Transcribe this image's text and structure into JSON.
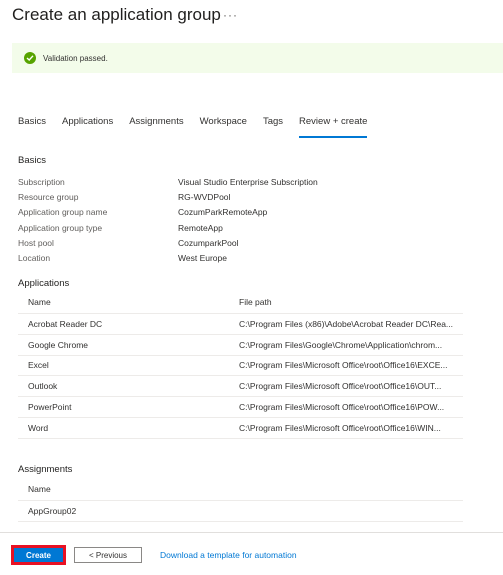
{
  "header": {
    "title": "Create an application group",
    "more_label": "···"
  },
  "validation": {
    "message": "Validation passed.",
    "icon": "check-circle-icon",
    "color": "#57a300"
  },
  "tabs": [
    {
      "label": "Basics"
    },
    {
      "label": "Applications"
    },
    {
      "label": "Assignments"
    },
    {
      "label": "Workspace"
    },
    {
      "label": "Tags"
    },
    {
      "label": "Review + create",
      "active": true
    }
  ],
  "basics": {
    "title": "Basics",
    "rows": [
      {
        "label": "Subscription",
        "value": "Visual Studio Enterprise Subscription"
      },
      {
        "label": "Resource group",
        "value": "RG-WVDPool"
      },
      {
        "label": "Application group name",
        "value": "CozumParkRemoteApp"
      },
      {
        "label": "Application group type",
        "value": "RemoteApp"
      },
      {
        "label": "Host pool",
        "value": "CozumparkPool"
      },
      {
        "label": "Location",
        "value": "West Europe"
      }
    ]
  },
  "applications": {
    "title": "Applications",
    "headers": {
      "name": "Name",
      "path": "File path"
    },
    "rows": [
      {
        "name": "Acrobat Reader DC",
        "path": "C:\\Program Files (x86)\\Adobe\\Acrobat Reader DC\\Rea..."
      },
      {
        "name": "Google Chrome",
        "path": "C:\\Program Files\\Google\\Chrome\\Application\\chrom..."
      },
      {
        "name": "Excel",
        "path": "C:\\Program Files\\Microsoft Office\\root\\Office16\\EXCE..."
      },
      {
        "name": "Outlook",
        "path": "C:\\Program Files\\Microsoft Office\\root\\Office16\\OUT..."
      },
      {
        "name": "PowerPoint",
        "path": "C:\\Program Files\\Microsoft Office\\root\\Office16\\POW..."
      },
      {
        "name": "Word",
        "path": "C:\\Program Files\\Microsoft Office\\root\\Office16\\WIN..."
      }
    ]
  },
  "assignments": {
    "title": "Assignments",
    "headers": {
      "name": "Name"
    },
    "rows": [
      {
        "name": "AppGroup02"
      }
    ]
  },
  "footer": {
    "create_label": "Create",
    "previous_label": "< Previous",
    "download_label": "Download a template for automation"
  },
  "colors": {
    "accent": "#0078d4",
    "highlight": "#e81123",
    "success_bg": "#f3fcea"
  }
}
